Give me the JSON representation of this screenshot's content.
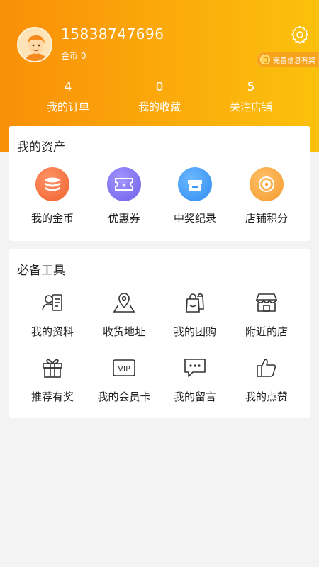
{
  "profile": {
    "phone": "15838747696",
    "coins_label": "金币 0",
    "complete_info_label": "完善信息有奖",
    "avatar_icon": "avatar-icon",
    "settings_icon": "gear-icon"
  },
  "stats": [
    {
      "value": "4",
      "label": "我的订单"
    },
    {
      "value": "0",
      "label": "我的收藏"
    },
    {
      "value": "5",
      "label": "关注店铺"
    }
  ],
  "assets": {
    "title": "我的资产",
    "items": [
      {
        "label": "我的金币",
        "icon": "coins-icon",
        "color": "#f36b3a"
      },
      {
        "label": "优惠券",
        "icon": "coupon-icon",
        "color": "#7d6ff0"
      },
      {
        "label": "中奖纪录",
        "icon": "prize-icon",
        "color": "#3d9af5"
      },
      {
        "label": "店铺积分",
        "icon": "points-icon",
        "color": "#f7a43a"
      }
    ]
  },
  "tools": {
    "title": "必备工具",
    "items": [
      {
        "label": "我的资料",
        "icon": "profile-icon"
      },
      {
        "label": "收货地址",
        "icon": "location-icon"
      },
      {
        "label": "我的团购",
        "icon": "group-buy-icon"
      },
      {
        "label": "附近的店",
        "icon": "store-icon"
      },
      {
        "label": "推荐有奖",
        "icon": "gift-icon"
      },
      {
        "label": "我的会员卡",
        "icon": "vip-card-icon"
      },
      {
        "label": "我的留言",
        "icon": "message-icon"
      },
      {
        "label": "我的点赞",
        "icon": "thumbs-up-icon"
      }
    ]
  }
}
